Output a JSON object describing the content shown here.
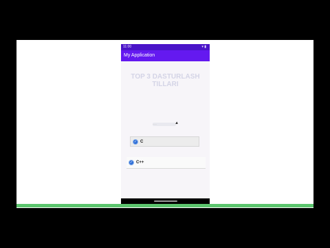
{
  "status_bar": {
    "time": "11:00",
    "icons": "▾ ▮"
  },
  "app_bar": {
    "title": "My Application",
    "color": "#6419f0"
  },
  "content": {
    "heading_line1": "TOP 3 DASTURLASH",
    "heading_line2": "TILLARI",
    "input_text": "------"
  },
  "options": [
    {
      "label": "C",
      "checked": true
    },
    {
      "label": "C++",
      "checked": true
    }
  ],
  "colors": {
    "status_bar": "#4a14c8",
    "app_bar": "#6419f0",
    "check": "#2f6fd8",
    "bottom_progress": "#5cc56e"
  }
}
